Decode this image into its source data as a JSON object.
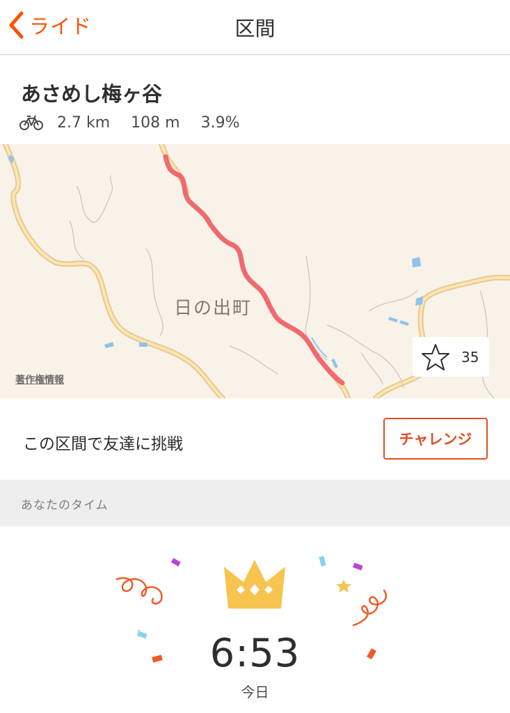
{
  "nav": {
    "back_label": "ライド",
    "title": "区間"
  },
  "segment": {
    "name": "あさめし梅ヶ谷",
    "activity_icon": "bike-icon",
    "distance": "2.7 km",
    "elevation": "108 m",
    "grade": "3.9%"
  },
  "map": {
    "town_label": "日の出町",
    "attribution": "著作権情報",
    "star_icon": "star-outline-icon",
    "star_count": "35",
    "route_color": "#f0696e"
  },
  "challenge": {
    "text": "この区間で友達に挑戦",
    "button_label": "チャレンジ",
    "accent_color": "#e04e25"
  },
  "your_time": {
    "header": "あなたのタイム",
    "icon": "crown-icon",
    "time": "6:53",
    "when": "今日"
  },
  "colors": {
    "brand": "#fc5200",
    "crown": "#f6c44f"
  }
}
